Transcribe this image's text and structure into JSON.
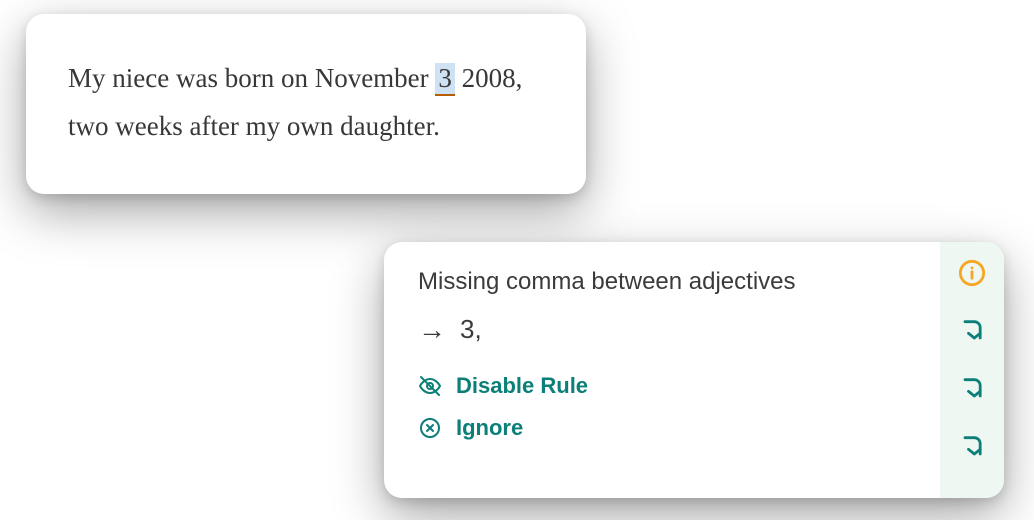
{
  "editor": {
    "sentence_before": "My niece was born on November ",
    "highlighted": "3",
    "sentence_after": " 2008, two weeks after my own daughter."
  },
  "suggestion": {
    "title": "Missing comma between adjectives",
    "replacement": "3,",
    "disable_label": "Disable Rule",
    "ignore_label": "Ignore"
  }
}
